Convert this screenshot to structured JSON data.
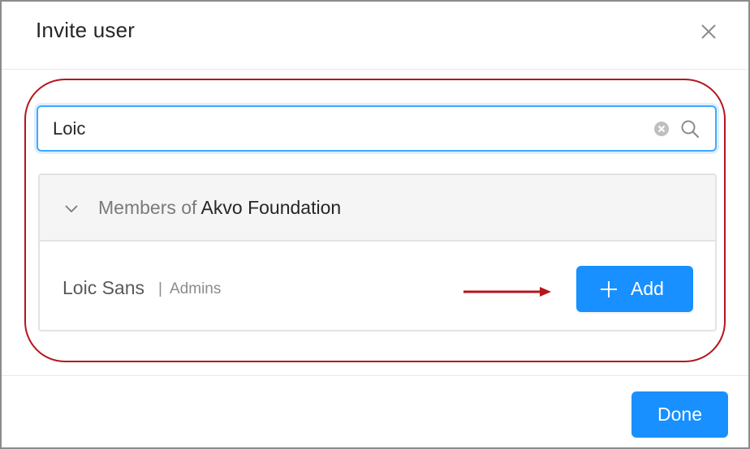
{
  "modal": {
    "title": "Invite user"
  },
  "search": {
    "value": "Loic",
    "placeholder": ""
  },
  "results": {
    "group": {
      "prefix": "Members of ",
      "organization": "Akvo Foundation",
      "expanded": true
    },
    "users": [
      {
        "name": "Loic Sans",
        "separator": "|",
        "role": "Admins",
        "action_label": "Add"
      }
    ]
  },
  "footer": {
    "done_label": "Done"
  },
  "icons": {
    "close": "close-icon",
    "clear": "clear-circle-icon",
    "search": "search-icon",
    "chevron": "chevron-down-icon",
    "plus": "plus-icon"
  },
  "colors": {
    "primary": "#1890ff",
    "annotation": "#b3161c",
    "input_focus": "#40a9ff"
  }
}
